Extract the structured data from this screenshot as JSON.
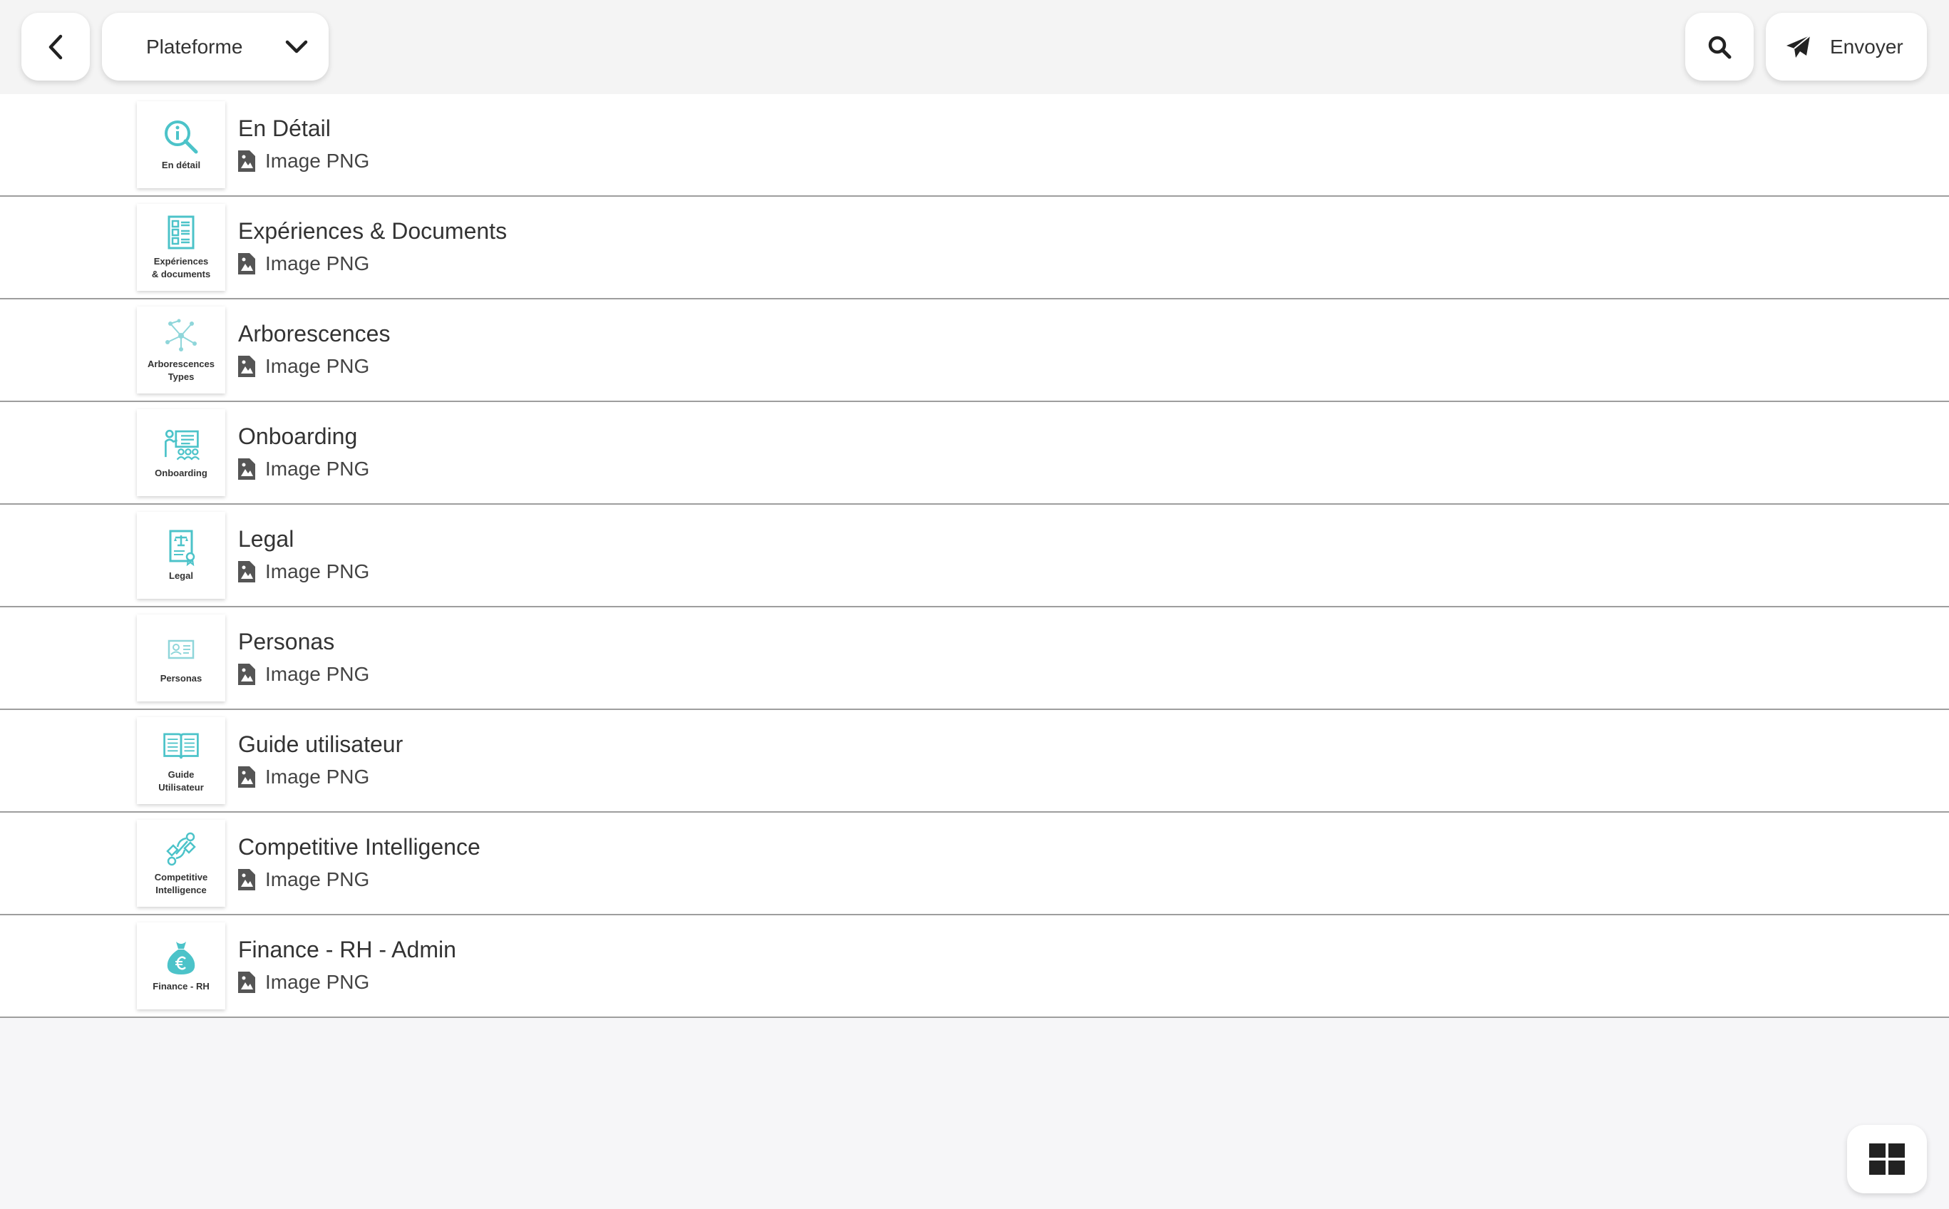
{
  "header": {
    "back_icon": "chevron-left-icon",
    "dropdown": {
      "selected": "Plateforme",
      "icon": "chevron-down-icon"
    },
    "search_icon": "search-icon",
    "send": {
      "label": "Envoyer",
      "icon": "paper-plane-icon"
    }
  },
  "accent_color": "#4cc3c9",
  "items": [
    {
      "title": "En Détail",
      "type": "Image PNG",
      "thumb_caption": "En détail",
      "thumb_icon": "info-magnifier-icon"
    },
    {
      "title": "Expériences & Documents",
      "type": "Image PNG",
      "thumb_caption": "Expériences\n& documents",
      "thumb_icon": "document-list-icon"
    },
    {
      "title": "Arborescences",
      "type": "Image PNG",
      "thumb_caption": "Arborescences\nTypes",
      "thumb_icon": "tree-network-icon"
    },
    {
      "title": "Onboarding",
      "type": "Image PNG",
      "thumb_caption": "Onboarding",
      "thumb_icon": "presentation-icon"
    },
    {
      "title": "Legal",
      "type": "Image PNG",
      "thumb_caption": "Legal",
      "thumb_icon": "legal-document-icon"
    },
    {
      "title": "Personas",
      "type": "Image PNG",
      "thumb_caption": "Personas",
      "thumb_icon": "id-card-icon"
    },
    {
      "title": "Guide utilisateur",
      "type": "Image PNG",
      "thumb_caption": "Guide\nUtilisateur",
      "thumb_icon": "open-book-icon"
    },
    {
      "title": "Competitive Intelligence",
      "type": "Image PNG",
      "thumb_caption": "Competitive\nIntelligence",
      "thumb_icon": "handshake-icon"
    },
    {
      "title": "Finance - RH - Admin",
      "type": "Image PNG",
      "thumb_caption": "Finance - RH",
      "thumb_icon": "money-bag-euro-icon"
    }
  ],
  "grid_icon": "grid-view-icon"
}
